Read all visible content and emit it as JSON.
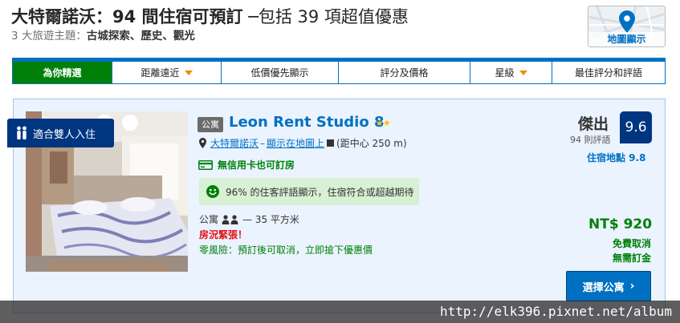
{
  "header": {
    "title_bold": "大特爾諾沃：94 間住宿可預訂",
    "title_rest": " ─包括 39 項超值優惠",
    "subtitle_prefix": "3 大旅遊主題：",
    "subtitle_themes": "古城探索、歷史、觀光"
  },
  "map_button": {
    "label": "地圖顯示",
    "icon": "map-pin-icon"
  },
  "sort_tabs": [
    {
      "label": "為你精選",
      "active": true,
      "dropdown": false
    },
    {
      "label": "距離遠近",
      "active": false,
      "dropdown": true
    },
    {
      "label": "低價優先顯示",
      "active": false,
      "dropdown": false
    },
    {
      "label": "評分及價格",
      "active": false,
      "dropdown": false
    },
    {
      "label": "星級",
      "active": false,
      "dropdown": true
    },
    {
      "label": "最佳評分和評語",
      "active": false,
      "dropdown": false
    }
  ],
  "hotel": {
    "badge": "適合雙人入住",
    "type_tag": "公寓",
    "name": "Leon Rent Studio 8",
    "stars": 2,
    "location_link": "大特爾諾沃",
    "map_link": "顯示在地圖上",
    "distance": "距中心 250 m",
    "no_card": "無信用卡也可訂房",
    "review_highlight": "96% 的住客評語顯示，住宿符合或超越期待",
    "room_type": "公寓",
    "room_size": "35 平方米",
    "scarcity": "房況緊張！",
    "no_risk": "零風險：預訂後可取消，立即搶下優惠價",
    "score_word": "傑出",
    "review_count": "94 則評語",
    "score": "9.6",
    "location_score": "住宿地點 9.8",
    "price": "NT$ 920",
    "free_cancel": "免費取消",
    "no_prepay": "無需訂金",
    "select_button": "選擇公寓"
  },
  "watermark": "http://elk396.pixnet.net/album",
  "colors": {
    "brand_blue": "#0071c2",
    "dark_blue": "#003580",
    "green": "#008009",
    "active_tab": "#008009",
    "scarcity_red": "#e21111",
    "card_bg": "#ebf3ff",
    "review_bg": "#d8f0d4",
    "star_yellow": "#febb02",
    "caret_orange": "#f08c00"
  }
}
